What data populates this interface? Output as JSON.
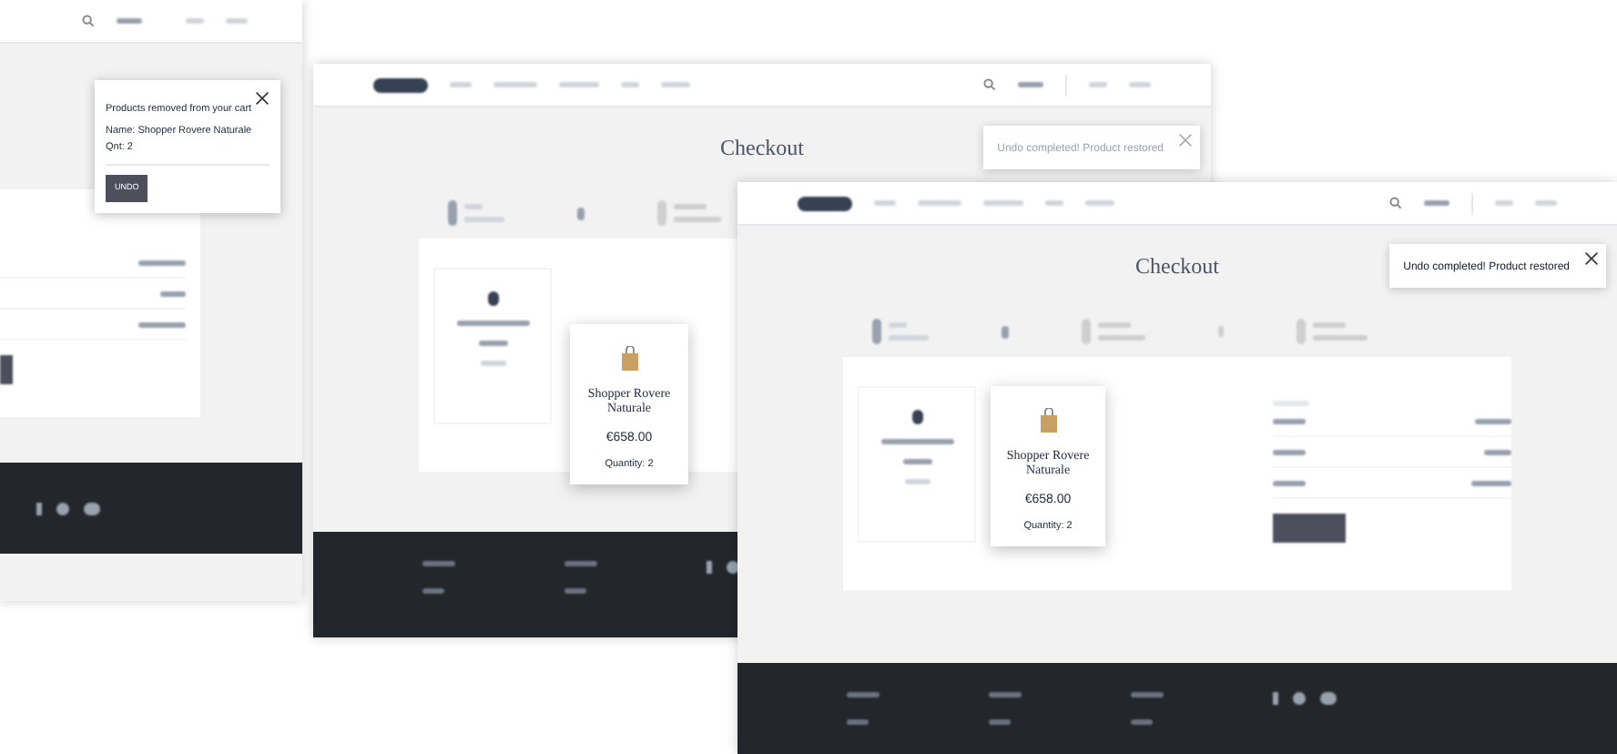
{
  "windows": [
    {
      "kind": "removed",
      "toast": {
        "title": "Products removed from your cart",
        "name": "Name: Shopper Rovere Naturale",
        "quantity": "Qnt: 2",
        "button": "UNDO"
      }
    },
    {
      "kind": "checkout",
      "title": "Checkout",
      "toast": {
        "text": "Undo completed! Product restored",
        "faded": true
      },
      "product": {
        "name": "Shopper Rovere Naturale",
        "price": "€658.00",
        "quantity": "Quantity: 2"
      }
    },
    {
      "kind": "checkout",
      "title": "Checkout",
      "toast": {
        "text": "Undo completed! Product restored",
        "faded": false
      },
      "product": {
        "name": "Shopper Rovere Naturale",
        "price": "€658.00",
        "quantity": "Quantity: 2"
      }
    }
  ]
}
